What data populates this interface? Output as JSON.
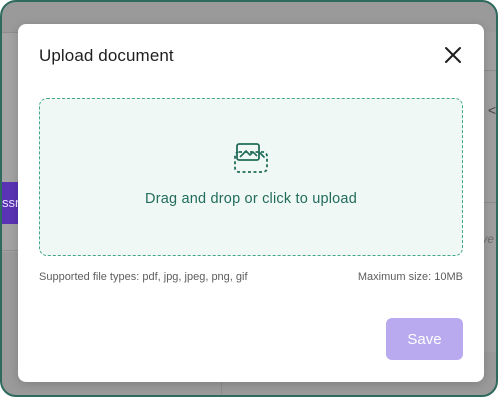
{
  "background": {
    "tab_fragment": "ssn",
    "right_fragment": "ve",
    "right_chevron": "<"
  },
  "modal": {
    "title": "Upload document",
    "close_icon": "close-icon",
    "dropzone": {
      "icon": "image-upload-icon",
      "text": "Drag and drop or click to upload"
    },
    "supported_types": "Supported file types: pdf, jpg, jpeg, png, gif",
    "max_size": "Maximum size: 10MB",
    "save_label": "Save"
  },
  "colors": {
    "frame_border": "#2f6a5e",
    "dropzone_bg": "#f0f8f6",
    "dropzone_border": "#43a58c",
    "dropzone_text": "#226c59",
    "save_button_bg": "#b9aaef",
    "background_tab": "#5a32b4"
  }
}
